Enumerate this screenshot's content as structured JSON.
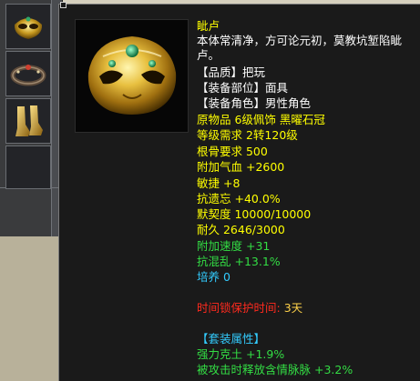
{
  "inventory": {
    "slots": [
      {
        "icon": "golden-mask-icon"
      },
      {
        "icon": "dark-circlet-icon"
      },
      {
        "icon": "golden-boots-icon"
      },
      {
        "icon": "empty-slot"
      }
    ]
  },
  "item": {
    "name": "眦卢",
    "description": "本体常清净，方可论元初，莫教坑堑陷眦卢。",
    "quality": "【品质】把玩",
    "slot": "【装备部位】面具",
    "role": "【装备角色】男性角色",
    "origin": "原物品 6级佩饰 黑曜石冠",
    "level_req": "等级需求 2转120级",
    "bone_req": "根骨要求 500",
    "hp_bonus": "附加气血 +2600",
    "agility": "敏捷 +8",
    "resist_forget": "抗遗忘 +40.0%",
    "tacit": "默契度 10000/10000",
    "durability": "耐久 2646/3000",
    "speed_bonus": "附加速度 +31",
    "resist_chaos": "抗混乱 +13.1%",
    "nurture": "培养 0",
    "lock_label": "时间锁保护时间:",
    "lock_value": "3天",
    "set_header": "【套装属性】",
    "set_attr_1": "强力克土 +1.9%",
    "set_attr_2": "被攻击时释放含情脉脉 +3.2%"
  }
}
